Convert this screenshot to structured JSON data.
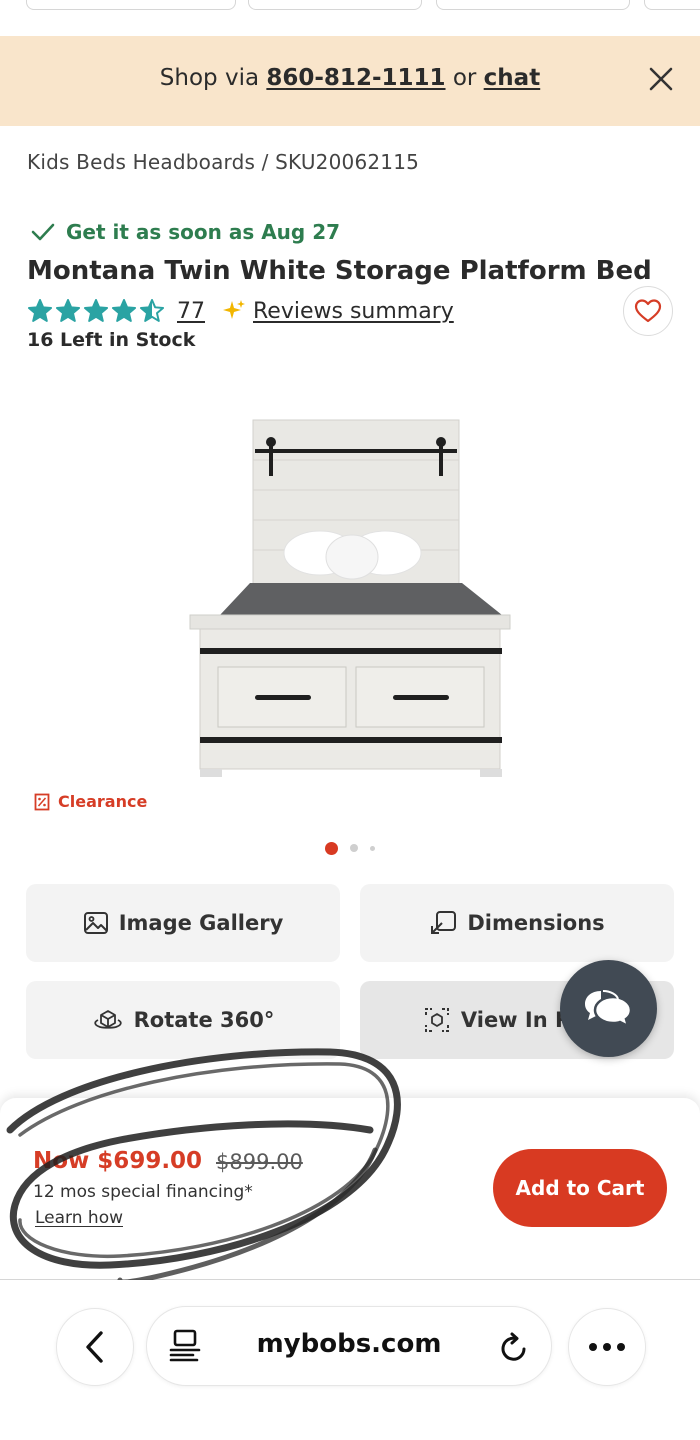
{
  "promo": {
    "prefix": "Shop via ",
    "phone": "860-812-1111",
    "middle": " or ",
    "chat": "chat"
  },
  "breadcrumb": "Kids Beds Headboards /  SKU20062115",
  "delivery": "Get it as soon as Aug 27",
  "product": {
    "title": "Montana Twin White Storage Platform Bed",
    "rating": 4.5,
    "review_count": "77",
    "reviews_summary": "Reviews summary",
    "stock": "16 Left in Stock",
    "badge": "Clearance"
  },
  "carousel": {
    "count": 3,
    "active": 0
  },
  "actions": {
    "image_gallery": "Image Gallery",
    "dimensions": "Dimensions",
    "rotate": "Rotate 360°",
    "view_in_room": "View In R"
  },
  "pricing": {
    "now": "Now $699.00",
    "was": "$899.00",
    "financing": "12 mos special financing*",
    "learn": "Learn how",
    "add_to_cart": "Add to Cart"
  },
  "browser": {
    "url": "mybobs.com"
  },
  "colors": {
    "accent": "#d83a22",
    "promo_bg": "#f9e5cb",
    "star": "#2aa3a3",
    "delivery_green": "#2e7d4f"
  }
}
